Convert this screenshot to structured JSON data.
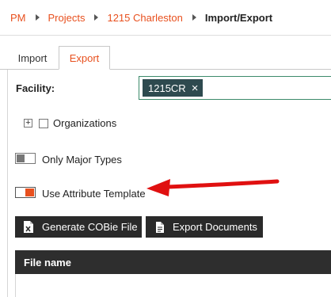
{
  "breadcrumb": {
    "items": [
      "PM",
      "Projects",
      "1215 Charleston"
    ],
    "current": "Import/Export"
  },
  "tabs": {
    "import_label": "Import",
    "export_label": "Export",
    "active": "Export"
  },
  "facility": {
    "label": "Facility:",
    "selected_chip": "1215CR"
  },
  "organizations": {
    "label": "Organizations",
    "checked": false
  },
  "options": {
    "only_major_types_label": "Only Major Types",
    "only_major_types_on": false,
    "use_attribute_template_label": "Use Attribute Template",
    "use_attribute_template_on": true
  },
  "buttons": {
    "generate_cobie_label": "Generate COBie File",
    "export_documents_label": "Export Documents"
  },
  "table": {
    "columns": [
      "File name"
    ]
  },
  "colors": {
    "accent": "#e8501e",
    "dark": "#2a2a2a",
    "chip": "#2e4a4f",
    "arrow": "#e01010"
  },
  "icons": {
    "generate_cobie": "excel-file-icon",
    "export_documents": "document-icon",
    "chip_remove": "close-icon",
    "expander": "plus-icon"
  }
}
